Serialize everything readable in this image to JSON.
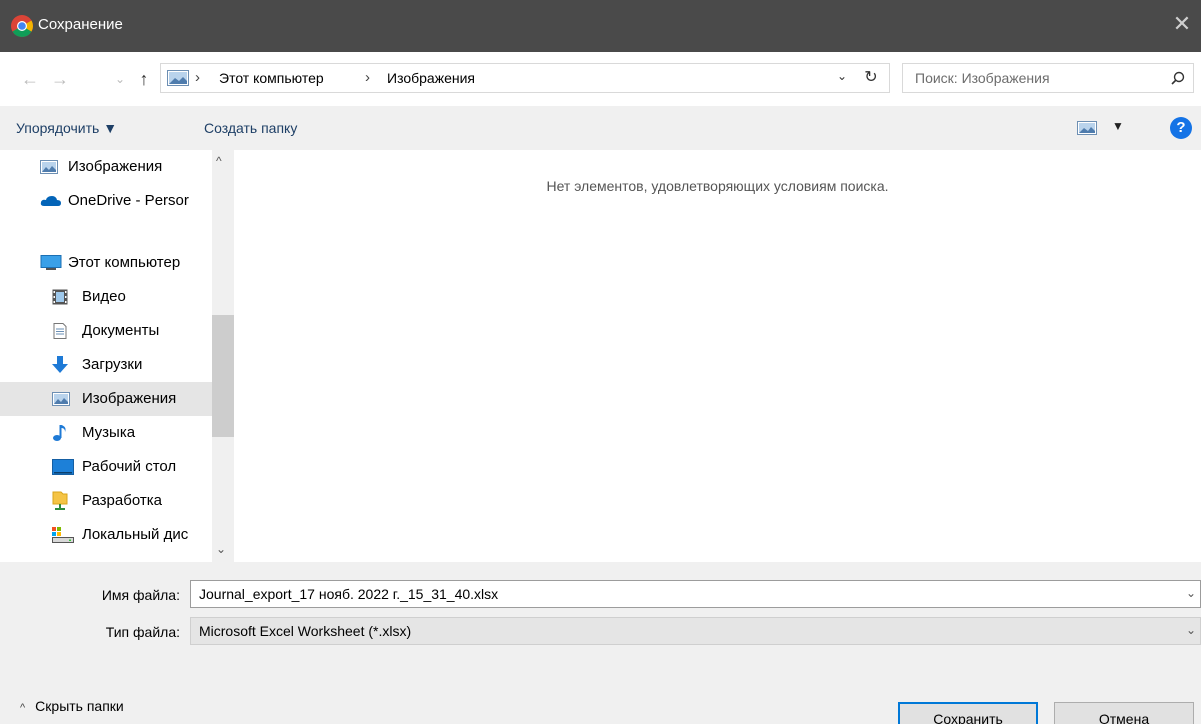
{
  "window": {
    "title": "Сохранение",
    "close_glyph": "✕"
  },
  "nav": {
    "back_icon": "←",
    "forward_icon": "→",
    "recent_icon": "⌄",
    "up_icon": "↑",
    "breadcrumbs": [
      "Этот компьютер",
      "Изображения"
    ],
    "separator": "›",
    "dropdown_icon": "⌄",
    "refresh_icon": "↻"
  },
  "search": {
    "placeholder": "Поиск: Изображения"
  },
  "toolbar": {
    "organize_label": "Упорядочить ▼",
    "new_folder_label": "Создать папку",
    "view_dropdown": "▼",
    "help_label": "?"
  },
  "sidebar": {
    "items": [
      {
        "label": "Изображения",
        "icon": "pictures-icon"
      },
      {
        "label": "OneDrive - Persor",
        "icon": "onedrive-icon"
      },
      {
        "label": "Этот компьютер",
        "icon": "computer-icon"
      },
      {
        "label": "Видео",
        "icon": "video-icon"
      },
      {
        "label": "Документы",
        "icon": "documents-icon"
      },
      {
        "label": "Загрузки",
        "icon": "downloads-icon"
      },
      {
        "label": "Изображения",
        "icon": "pictures-icon",
        "selected": true
      },
      {
        "label": "Музыка",
        "icon": "music-icon"
      },
      {
        "label": "Рабочий стол",
        "icon": "desktop-icon"
      },
      {
        "label": "Разработка",
        "icon": "folder-icon"
      },
      {
        "label": "Локальный дис",
        "icon": "drive-icon"
      }
    ],
    "scroll_up": "^",
    "scroll_down": "⌄"
  },
  "content": {
    "empty_message": "Нет элементов, удовлетворяющих условиям поиска."
  },
  "form": {
    "filename_label": "Имя файла:",
    "filename_value": "Journal_export_17 нояб. 2022 г._15_31_40.xlsx",
    "filetype_label": "Тип файла:",
    "filetype_value": "Microsoft Excel Worksheet (*.xlsx)",
    "chevron": "⌄"
  },
  "footer": {
    "hide_folders_label": "Скрыть папки",
    "hide_folders_icon": "^",
    "save_label": "Сохранить",
    "cancel_label": "Отмена"
  },
  "colors": {
    "titlebar": "#4a4a4a",
    "accent": "#0078d7",
    "toolbar_bg": "#f0f0f0",
    "link_text": "#1e3f66"
  }
}
